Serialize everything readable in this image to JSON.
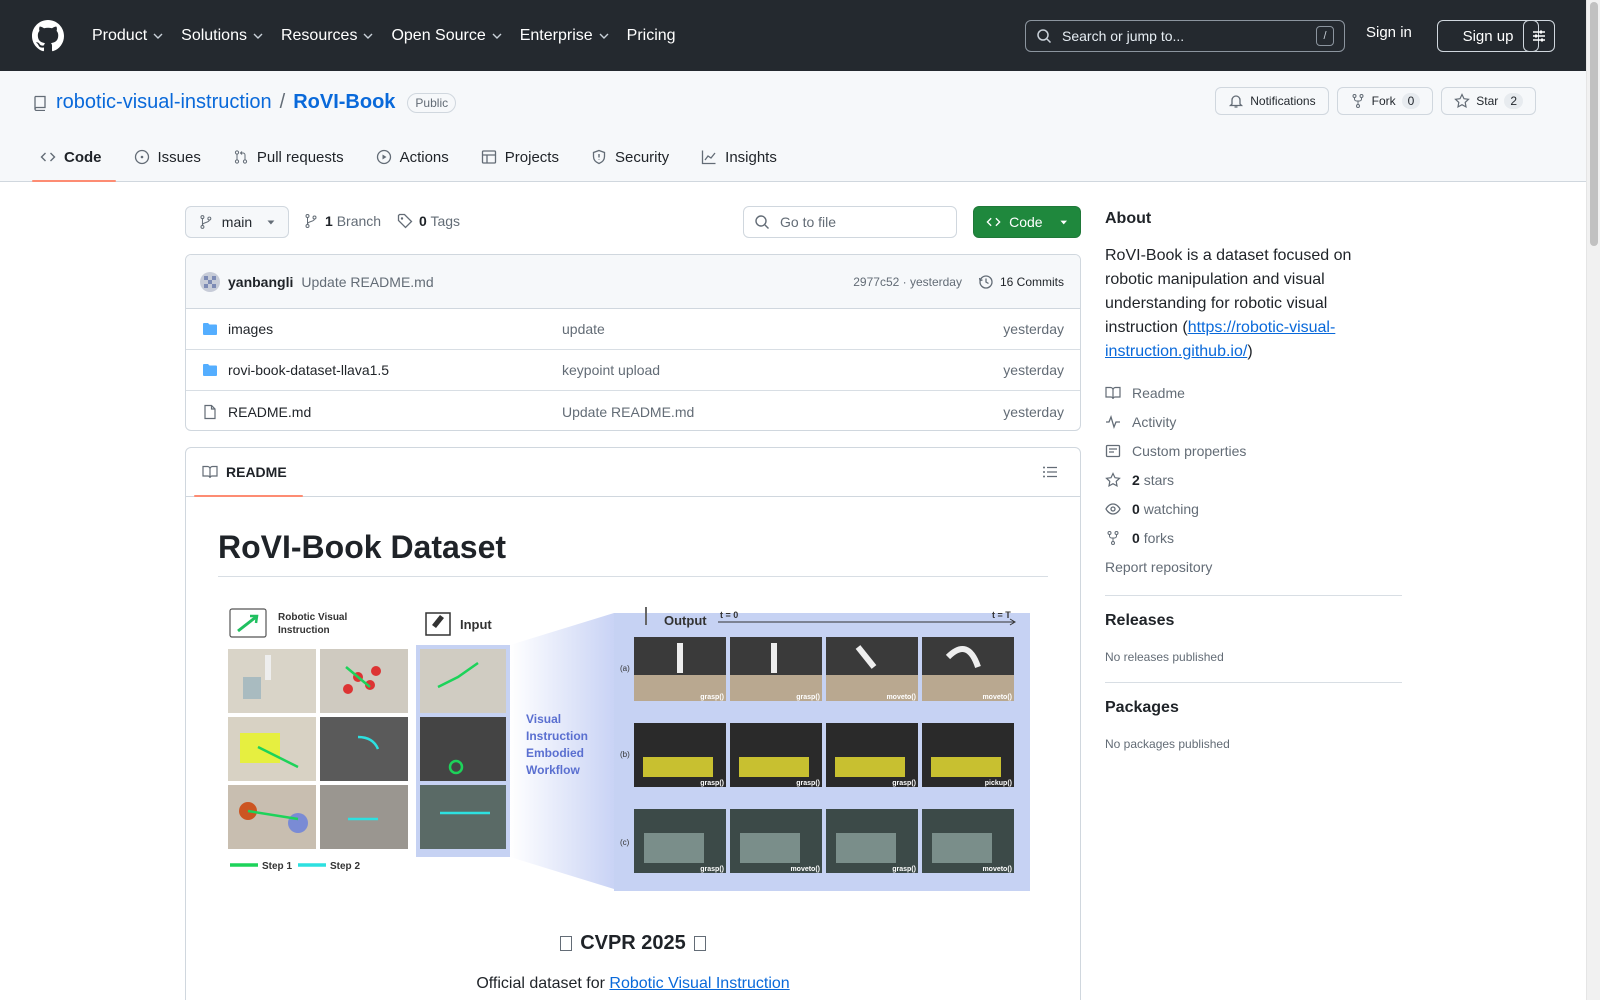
{
  "header": {
    "nav": [
      "Product",
      "Solutions",
      "Resources",
      "Open Source",
      "Enterprise",
      "Pricing"
    ],
    "search_placeholder": "Search or jump to...",
    "search_shortcut": "/",
    "signin": "Sign in",
    "signup": "Sign up"
  },
  "repo": {
    "owner": "robotic-visual-instruction",
    "separator": "/",
    "name": "RoVI-Book",
    "visibility": "Public",
    "notifications": "Notifications",
    "fork_label": "Fork",
    "fork_count": "0",
    "star_label": "Star",
    "star_count": "2",
    "tabs": [
      "Code",
      "Issues",
      "Pull requests",
      "Actions",
      "Projects",
      "Security",
      "Insights"
    ]
  },
  "toolbar": {
    "branch": "main",
    "branch_count": "1",
    "branch_label": "Branch",
    "tag_count": "0",
    "tag_label": "Tags",
    "goto_placeholder": "Go to file",
    "code_label": "Code"
  },
  "commit": {
    "author": "yanbangli",
    "message": "Update README.md",
    "hash_time": "2977c52 · yesterday",
    "commits": "16 Commits"
  },
  "files": [
    {
      "name": "images",
      "type": "folder",
      "commit": "update",
      "time": "yesterday"
    },
    {
      "name": "rovi-book-dataset-llava1.5",
      "type": "folder",
      "commit": "keypoint upload",
      "time": "yesterday"
    },
    {
      "name": "README.md",
      "type": "file",
      "commit": "Update README.md",
      "time": "yesterday"
    }
  ],
  "readme": {
    "tab": "README",
    "title": "RoVI-Book Dataset",
    "figure": {
      "left_label_1": "Robotic Visual",
      "left_label_2": "Instruction",
      "input_label": "Input",
      "output_label": "Output",
      "t0": "t = 0",
      "tT": "t = T",
      "viewf": [
        "Visual",
        "Instruction",
        "Embodied",
        "Workflow"
      ],
      "step1": "Step 1",
      "step2": "Step 2",
      "row_labels": [
        "(a)",
        "(b)",
        "(c)"
      ],
      "row_a": [
        "grasp()",
        "grasp()",
        "moveto()",
        "moveto()"
      ],
      "row_b": [
        "grasp()",
        "grasp()",
        "grasp()",
        "pickup()"
      ],
      "row_c": [
        "grasp()",
        "moveto()",
        "grasp()",
        "moveto()"
      ]
    },
    "cvpr": "CVPR 2025",
    "official_prefix": "Official dataset for",
    "official_link": "Robotic Visual Instruction"
  },
  "about": {
    "heading": "About",
    "desc": "RoVI-Book is a dataset focused on robotic manipulation and visual understanding for robotic visual instruction (",
    "link": "https://robotic-visual-instruction.github.io/",
    "desc_end": ")",
    "readme": "Readme",
    "activity": "Activity",
    "custom_props": "Custom properties",
    "stars_count": "2",
    "stars_label": "stars",
    "watching_count": "0",
    "watching_label": "watching",
    "forks_count": "0",
    "forks_label": "forks",
    "report": "Report repository"
  },
  "releases": {
    "heading": "Releases",
    "text": "No releases published"
  },
  "packages": {
    "heading": "Packages",
    "text": "No packages published"
  },
  "colors": {
    "header_bg": "#24292f",
    "link": "#0969da",
    "code_btn": "#1f883d",
    "tab_underline": "#fd8c73"
  }
}
